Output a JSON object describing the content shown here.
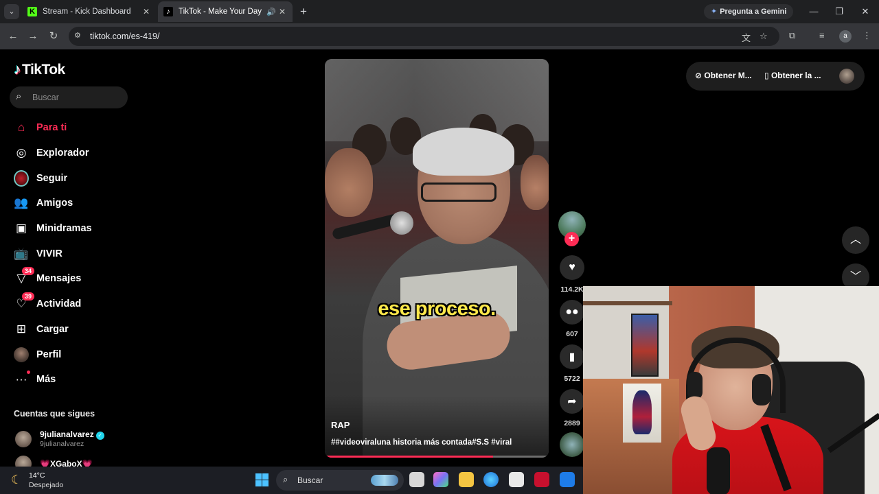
{
  "browser": {
    "tabs": [
      {
        "title": "Stream - Kick Dashboard",
        "favicon": "K",
        "color": "#53fc18",
        "active": false
      },
      {
        "title": "TikTok - Make Your Day",
        "favicon": "♪",
        "color": "#000000",
        "active": true
      }
    ],
    "gemini_label": "Pregunta a Gemini",
    "url": "tiktok.com/es-419/",
    "profile_initial": "a"
  },
  "tiktok": {
    "logo": "TikTok",
    "search_placeholder": "Buscar",
    "nav": [
      {
        "label": "Para ti",
        "icon": "home-icon",
        "active": true
      },
      {
        "label": "Explorador",
        "icon": "compass-icon"
      },
      {
        "label": "Seguir",
        "icon": "following-avatar"
      },
      {
        "label": "Amigos",
        "icon": "friends-icon"
      },
      {
        "label": "Minidramas",
        "icon": "minidramas-icon"
      },
      {
        "label": "VIVIR",
        "icon": "live-icon"
      },
      {
        "label": "Mensajes",
        "icon": "messages-icon",
        "badge": "34"
      },
      {
        "label": "Actividad",
        "icon": "activity-icon",
        "badge": "39"
      },
      {
        "label": "Cargar",
        "icon": "upload-icon"
      },
      {
        "label": "Perfil",
        "icon": "profile-avatar"
      },
      {
        "label": "Más",
        "icon": "more-icon"
      }
    ],
    "following_title": "Cuentas que sigues",
    "following": [
      {
        "name": "9julianalvarez",
        "handle": "9julianalvarez",
        "verified": true
      },
      {
        "name": "💗XGaboX💗",
        "handle": ""
      }
    ],
    "get_app": [
      "Obtener M...",
      "Obtener la ..."
    ],
    "video": {
      "caption_overlay": "ese proceso.",
      "author": "RAP",
      "description": "##videoviraluna historia más contada#S.S #viral",
      "progress_percent": 75
    },
    "actions": {
      "likes": "114.2K",
      "comments": "607",
      "saves": "5722",
      "shares": "2889"
    }
  },
  "taskbar": {
    "temperature": "14°C",
    "weather": "Despejado",
    "search_placeholder": "Buscar"
  }
}
